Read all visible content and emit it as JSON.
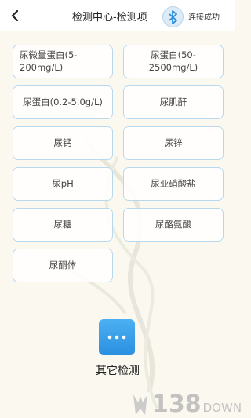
{
  "header": {
    "back_icon": "chevron-left-icon",
    "title": "检测中心-检测项",
    "bluetooth_icon": "bluetooth-icon",
    "status": "连接成功"
  },
  "items": [
    {
      "label": "尿微量蛋白(5-200mg/L)"
    },
    {
      "label": "尿蛋白(50-2500mg/L)"
    },
    {
      "label": "尿蛋白(0.2-5.0g/L)"
    },
    {
      "label": "尿肌酐"
    },
    {
      "label": "尿钙"
    },
    {
      "label": "尿锌"
    },
    {
      "label": "尿pH"
    },
    {
      "label": "尿亚硝酸盐"
    },
    {
      "label": "尿糖"
    },
    {
      "label": "尿酪氨酸"
    },
    {
      "label": "尿酮体"
    }
  ],
  "other": {
    "icon": "more-dots-icon",
    "label": "其它检测"
  },
  "watermark": {
    "number": "138",
    "text": "DOWN"
  },
  "colors": {
    "accent": "#2a8fe0",
    "border": "#b8d8f0",
    "background": "#fbf9ef"
  }
}
